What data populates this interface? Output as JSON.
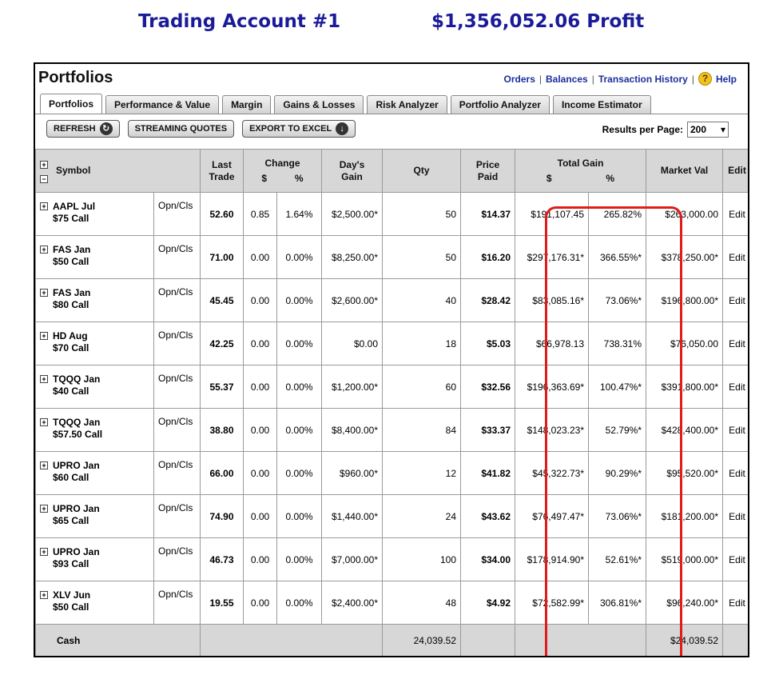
{
  "headline": {
    "account": "Trading Account #1",
    "profit": "$1,356,052.06 Profit"
  },
  "panel": {
    "title": "Portfolios",
    "links": [
      "Orders",
      "Balances",
      "Transaction History"
    ],
    "help": "Help",
    "help_icon_glyph": "?"
  },
  "tabs": [
    "Portfolios",
    "Performance & Value",
    "Margin",
    "Gains & Losses",
    "Risk Analyzer",
    "Portfolio Analyzer",
    "Income Estimator"
  ],
  "toolbar": {
    "refresh": "REFRESH",
    "streaming": "STREAMING QUOTES",
    "export": "EXPORT TO EXCEL",
    "results_label": "Results per Page:",
    "results_value": "200"
  },
  "headers": {
    "symbol": "Symbol",
    "last_trade_1": "Last",
    "last_trade_2": "Trade",
    "change": "Change",
    "change_d": "$",
    "change_p": "%",
    "days_gain_1": "Day's",
    "days_gain_2": "Gain",
    "qty": "Qty",
    "price_paid": "Price Paid",
    "total_gain": "Total Gain",
    "tg_d": "$",
    "tg_p": "%",
    "market_val": "Market Val",
    "edit": "Edit"
  },
  "rows": [
    {
      "sym1": "AAPL Jul",
      "sym2": "$75 Call",
      "type": "Opn/Cls",
      "last": "52.60",
      "chg": "0.85",
      "chgp": "1.64%",
      "day": "$2,500.00*",
      "qty": "50",
      "paid": "$14.37",
      "tg": "$191,107.45",
      "tgp": "265.82%",
      "mv": "$263,000.00",
      "edit": "Edit"
    },
    {
      "sym1": "FAS Jan",
      "sym2": "$50 Call",
      "type": "Opn/Cls",
      "last": "71.00",
      "chg": "0.00",
      "chgp": "0.00%",
      "day": "$8,250.00*",
      "qty": "50",
      "paid": "$16.20",
      "tg": "$297,176.31*",
      "tgp": "366.55%*",
      "mv": "$378,250.00*",
      "edit": "Edit"
    },
    {
      "sym1": "FAS Jan",
      "sym2": "$80 Call",
      "type": "Opn/Cls",
      "last": "45.45",
      "chg": "0.00",
      "chgp": "0.00%",
      "day": "$2,600.00*",
      "qty": "40",
      "paid": "$28.42",
      "tg": "$83,085.16*",
      "tgp": "73.06%*",
      "mv": "$196,800.00*",
      "edit": "Edit"
    },
    {
      "sym1": "HD Aug",
      "sym2": "$70 Call",
      "type": "Opn/Cls",
      "last": "42.25",
      "chg": "0.00",
      "chgp": "0.00%",
      "day": "$0.00",
      "qty": "18",
      "paid": "$5.03",
      "tg": "$66,978.13",
      "tgp": "738.31%",
      "mv": "$76,050.00",
      "edit": "Edit"
    },
    {
      "sym1": "TQQQ Jan",
      "sym2": "$40 Call",
      "type": "Opn/Cls",
      "last": "55.37",
      "chg": "0.00",
      "chgp": "0.00%",
      "day": "$1,200.00*",
      "qty": "60",
      "paid": "$32.56",
      "tg": "$196,363.69*",
      "tgp": "100.47%*",
      "mv": "$391,800.00*",
      "edit": "Edit"
    },
    {
      "sym1": "TQQQ Jan",
      "sym2": "$57.50 Call",
      "type": "Opn/Cls",
      "last": "38.80",
      "chg": "0.00",
      "chgp": "0.00%",
      "day": "$8,400.00*",
      "qty": "84",
      "paid": "$33.37",
      "tg": "$148,023.23*",
      "tgp": "52.79%*",
      "mv": "$428,400.00*",
      "edit": "Edit"
    },
    {
      "sym1": "UPRO Jan",
      "sym2": "$60 Call",
      "type": "Opn/Cls",
      "last": "66.00",
      "chg": "0.00",
      "chgp": "0.00%",
      "day": "$960.00*",
      "qty": "12",
      "paid": "$41.82",
      "tg": "$45,322.73*",
      "tgp": "90.29%*",
      "mv": "$95,520.00*",
      "edit": "Edit"
    },
    {
      "sym1": "UPRO Jan",
      "sym2": "$65 Call",
      "type": "Opn/Cls",
      "last": "74.90",
      "chg": "0.00",
      "chgp": "0.00%",
      "day": "$1,440.00*",
      "qty": "24",
      "paid": "$43.62",
      "tg": "$76,497.47*",
      "tgp": "73.06%*",
      "mv": "$181,200.00*",
      "edit": "Edit"
    },
    {
      "sym1": "UPRO Jan",
      "sym2": "$93 Call",
      "type": "Opn/Cls",
      "last": "46.73",
      "chg": "0.00",
      "chgp": "0.00%",
      "day": "$7,000.00*",
      "qty": "100",
      "paid": "$34.00",
      "tg": "$178,914.90*",
      "tgp": "52.61%*",
      "mv": "$519,000.00*",
      "edit": "Edit"
    },
    {
      "sym1": "XLV Jun",
      "sym2": "$50 Call",
      "type": "Opn/Cls",
      "last": "19.55",
      "chg": "0.00",
      "chgp": "0.00%",
      "day": "$2,400.00*",
      "qty": "48",
      "paid": "$4.92",
      "tg": "$72,582.99*",
      "tgp": "306.81%*",
      "mv": "$96,240.00*",
      "edit": "Edit"
    }
  ],
  "cash": {
    "label": "Cash",
    "qty": "24,039.52",
    "mv": "$24,039.52"
  },
  "colors": {
    "headline": "#1b1b9a",
    "links": "#1c2f9c",
    "highlight": "#e01c1c",
    "header_bg": "#d7d7d7"
  }
}
